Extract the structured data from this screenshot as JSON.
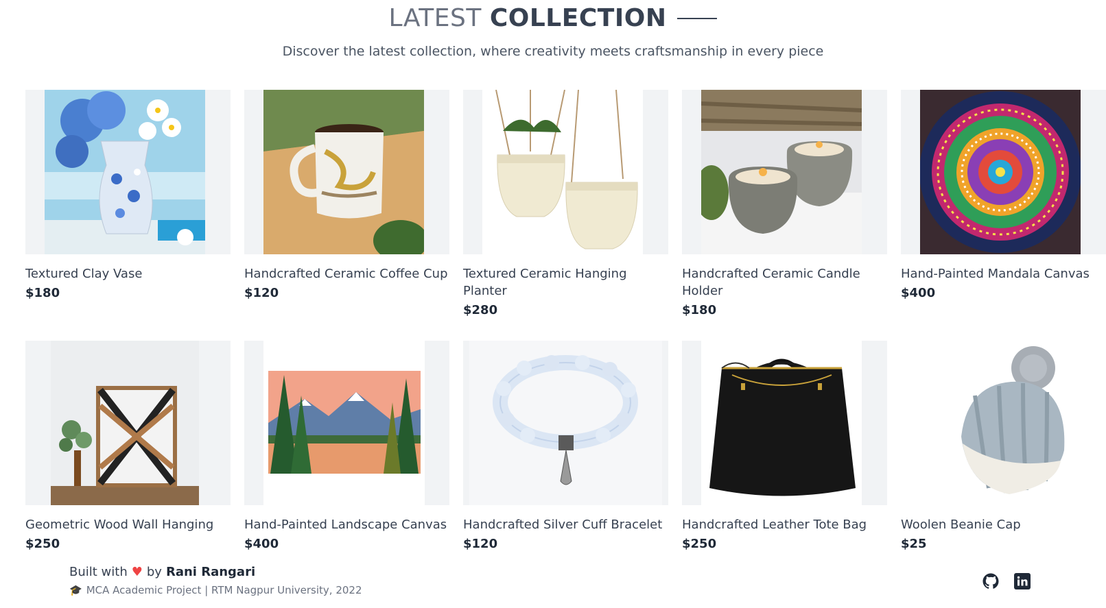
{
  "header": {
    "title_light": "LATEST",
    "title_bold": "COLLECTION",
    "subtitle": "Discover the latest collection, where creativity meets craftsmanship in every piece"
  },
  "products": [
    {
      "name": "Textured Clay Vase",
      "price": "$180",
      "image": "blue-flowers-vase-image"
    },
    {
      "name": "Handcrafted Ceramic Coffee Cup",
      "price": "$120",
      "image": "marble-mug-image"
    },
    {
      "name": "Textured Ceramic Hanging Planter",
      "price": "$280",
      "image": "hanging-planters-image"
    },
    {
      "name": "Handcrafted Ceramic Candle Holder",
      "price": "$180",
      "image": "candle-holders-image"
    },
    {
      "name": "Hand-Painted Mandala Canvas",
      "price": "$400",
      "image": "mandala-dot-art-image"
    },
    {
      "name": "Geometric Wood Wall Hanging",
      "price": "$250",
      "image": "geometric-wood-art-image"
    },
    {
      "name": "Hand-Painted Landscape Canvas",
      "price": "$400",
      "image": "landscape-painting-image"
    },
    {
      "name": "Handcrafted Silver Cuff Bracelet",
      "price": "$120",
      "image": "bead-bracelet-image"
    },
    {
      "name": "Handcrafted Leather Tote Bag",
      "price": "$250",
      "image": "black-tote-bag-image"
    },
    {
      "name": "Woolen Beanie Cap",
      "price": "$25",
      "image": "grey-beanie-image"
    }
  ],
  "footer": {
    "built_with": "Built with",
    "by": "by",
    "author": "Rani Rangari",
    "credit": "MCA Academic Project | RTM Nagpur University, 2022",
    "icons": [
      "github-icon",
      "linkedin-icon"
    ]
  }
}
